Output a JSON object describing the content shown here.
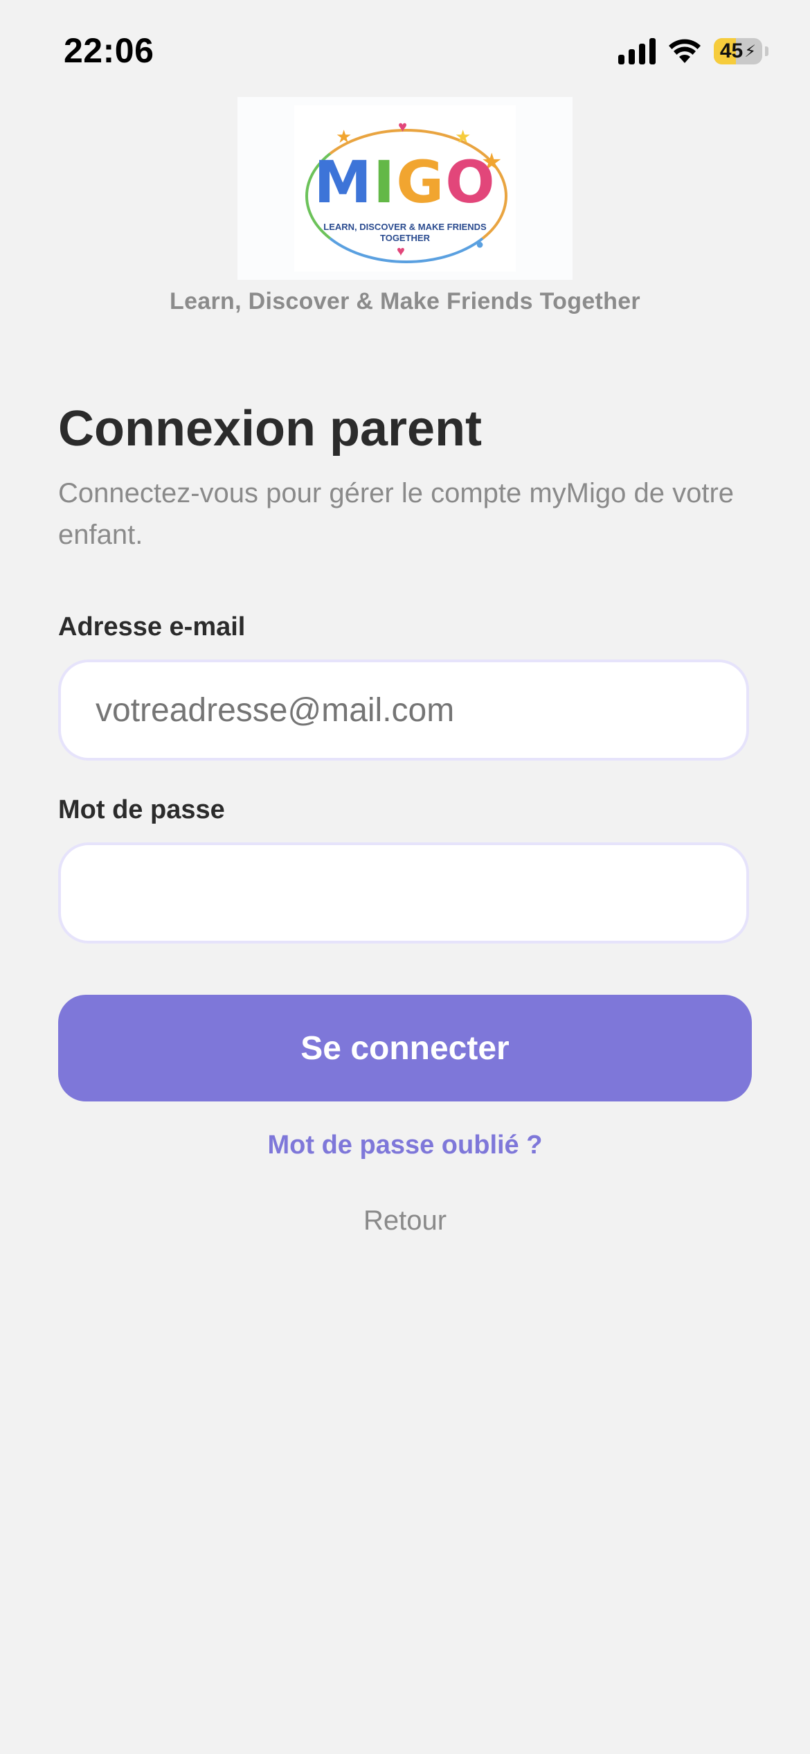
{
  "status_bar": {
    "time": "22:06",
    "battery_percent": "45",
    "battery_level": 0.45,
    "battery_charging_glyph": "⚡",
    "icons": [
      "cellular-signal-icon",
      "wifi-icon",
      "battery-icon"
    ]
  },
  "logo": {
    "letters": [
      "M",
      "I",
      "G",
      "O"
    ],
    "tagline_line1": "LEARN, DISCOVER & MAKE FRIENDS",
    "tagline_line2": "TOGETHER"
  },
  "subtitle": "Learn, Discover & Make Friends Together",
  "login": {
    "title": "Connexion parent",
    "description": "Connectez-vous pour gérer le compte myMigo de votre enfant.",
    "email_label": "Adresse e-mail",
    "email_placeholder": "votreadresse@mail.com",
    "email_value": "",
    "password_label": "Mot de passe",
    "password_value": "",
    "submit_label": "Se connecter",
    "forgot_label": "Mot de passe oublié ?",
    "back_label": "Retour"
  },
  "colors": {
    "background": "#f2f2f2",
    "accent": "#7e77d9",
    "input_border": "#e6e3fb",
    "battery_yellow": "#f6cc3c"
  }
}
